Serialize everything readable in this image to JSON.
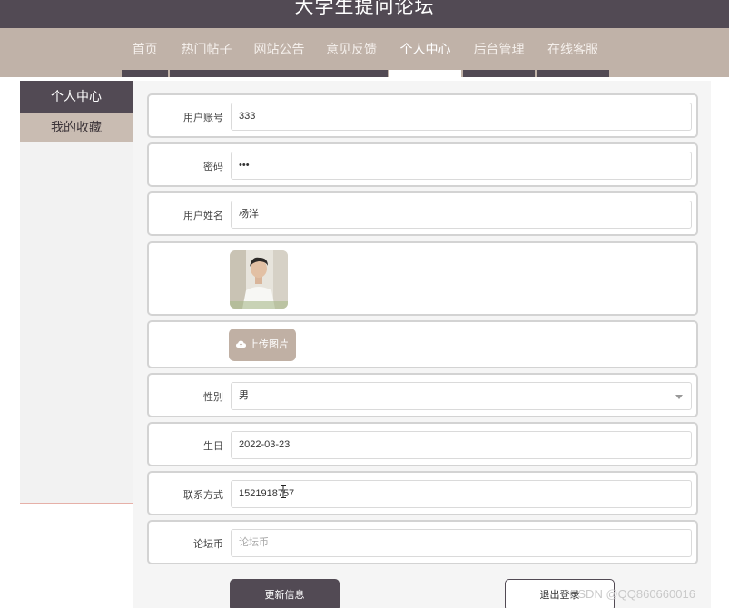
{
  "site": {
    "title": "大学生提问论坛"
  },
  "nav": {
    "items": [
      {
        "label": "首页"
      },
      {
        "label": "热门帖子"
      },
      {
        "label": "网站公告"
      },
      {
        "label": "意见反馈"
      },
      {
        "label": "个人中心",
        "active": true
      },
      {
        "label": "后台管理"
      },
      {
        "label": "在线客服"
      }
    ]
  },
  "sidebar": {
    "items": [
      {
        "label": "个人中心",
        "active": true
      },
      {
        "label": "我的收藏"
      }
    ]
  },
  "form": {
    "account": {
      "label": "用户账号",
      "value": "333"
    },
    "password": {
      "label": "密码",
      "value": "•••"
    },
    "name": {
      "label": "用户姓名",
      "value": "杨洋"
    },
    "upload": {
      "label": "上传图片",
      "icon": "cloud-upload-icon"
    },
    "gender": {
      "label": "性别",
      "value": "男"
    },
    "birthday": {
      "label": "生日",
      "value": "2022-03-23"
    },
    "phone": {
      "label": "联系方式",
      "value": "15219187̶57"
    },
    "coins": {
      "label": "论坛币",
      "placeholder": "论坛币"
    }
  },
  "actions": {
    "update": "更新信息",
    "logout": "退出登录"
  },
  "watermark": "CSDN @QQ860660016",
  "colors": {
    "primary": "#524a54",
    "accent": "#c0b2a8",
    "panel": "#f5f5f5"
  }
}
